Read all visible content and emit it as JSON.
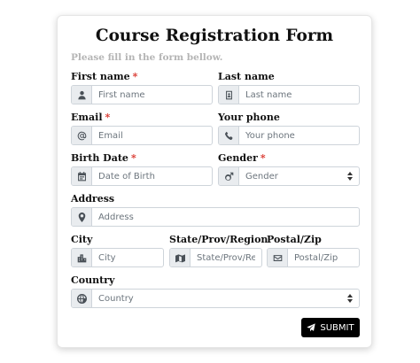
{
  "form": {
    "title": "Course Registration Form",
    "subtitle": "Please fill in the form bellow.",
    "required_marker": "*",
    "fields": {
      "first_name": {
        "label": "First name",
        "placeholder": "First name",
        "icon": "user-icon"
      },
      "last_name": {
        "label": "Last name",
        "placeholder": "Last name",
        "icon": "id-card-icon"
      },
      "email": {
        "label": "Email",
        "placeholder": "Email",
        "icon": "at-icon"
      },
      "phone": {
        "label": "Your phone",
        "placeholder": "Your phone",
        "icon": "phone-icon"
      },
      "birth_date": {
        "label": "Birth Date",
        "placeholder": "Date of Birth",
        "icon": "calendar-icon"
      },
      "gender": {
        "label": "Gender",
        "selected": "Gender",
        "icon": "mars-icon"
      },
      "address": {
        "label": "Address",
        "placeholder": "Address",
        "icon": "map-marker-icon"
      },
      "city": {
        "label": "City",
        "placeholder": "City",
        "icon": "city-icon"
      },
      "state": {
        "label": "State/Prov/Region",
        "placeholder": "State/Prov/Region",
        "icon": "map-icon"
      },
      "postal": {
        "label": "Postal/Zip",
        "placeholder": "Postal/Zip",
        "icon": "envelope-icon"
      },
      "country": {
        "label": "Country",
        "selected": "Country",
        "icon": "globe-icon"
      }
    },
    "submit_label": "SUBMIT",
    "submit_icon": "paper-plane-icon"
  }
}
